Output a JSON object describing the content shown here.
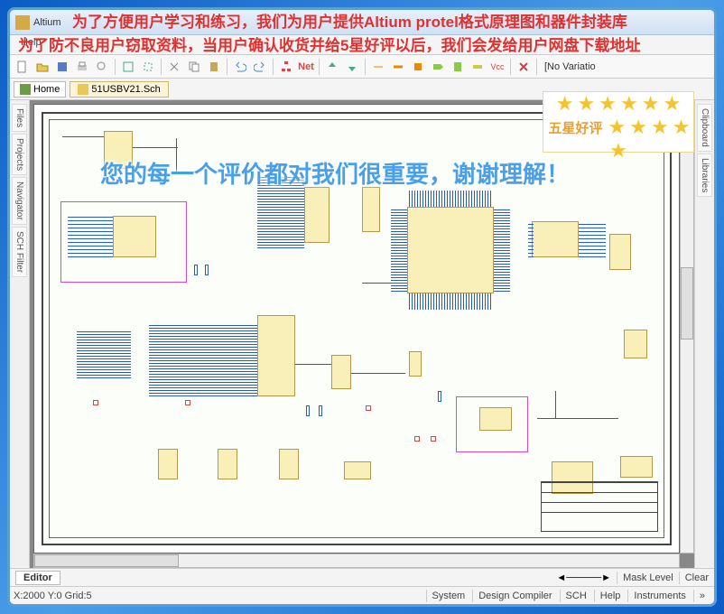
{
  "window": {
    "app_name": "Altium"
  },
  "overlays": {
    "red_line1": "为了方便用户学习和练习，我们为用户提供Altium protel格式原理图和器件封装库",
    "red_line2": "为了防不良用户窃取资料，当用户确认收货并给5星好评以后，我们会发给用户网盘下载地址",
    "blue_line": "您的每一个评价都对我们很重要，谢谢理解！",
    "five_star_label": "五星好评"
  },
  "menu": {
    "help": "Help"
  },
  "toolbar": {
    "variation": "[No Variatio"
  },
  "docbar": {
    "home": "Home",
    "active_tab": "51USBV21.Sch"
  },
  "left_rail": {
    "files": "Files",
    "projects": "Projects",
    "navigator": "Navigator",
    "sch_filter": "SCH Filter"
  },
  "right_rail": {
    "clipboard": "Clipboard",
    "libraries": "Libraries"
  },
  "editor_bar": {
    "editor": "Editor"
  },
  "statusbar": {
    "coords": "X:2000 Y:0  Grid:5",
    "mask_level": "Mask Level",
    "clear": "Clear",
    "system": "System",
    "design_compiler": "Design Compiler",
    "sch": "SCH",
    "help": "Help",
    "instruments": "Instruments"
  }
}
